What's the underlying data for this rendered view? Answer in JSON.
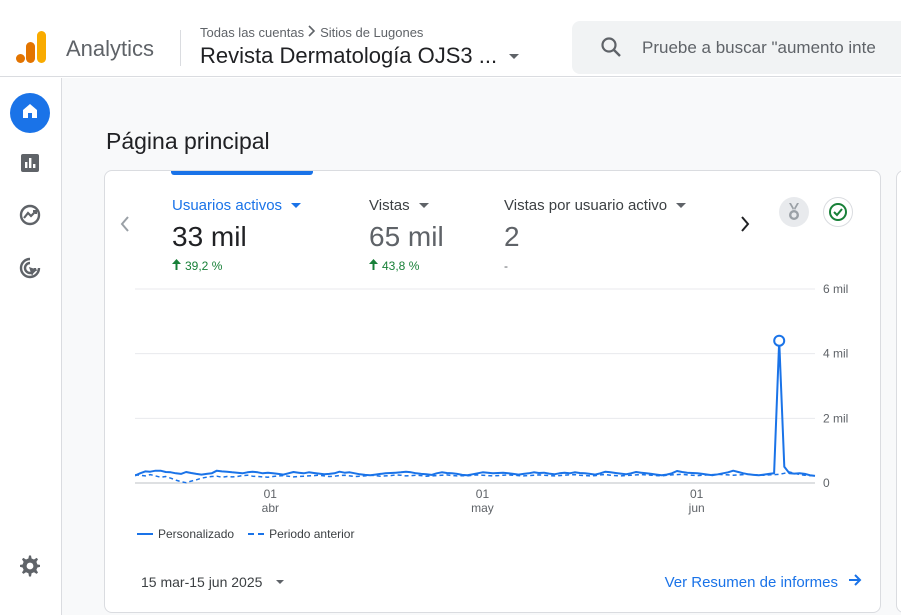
{
  "app": {
    "name": "Analytics"
  },
  "breadcrumb": {
    "account": "Todas las cuentas",
    "property_group": "Sitios de Lugones"
  },
  "property": {
    "name": "Revista Dermatología OJS3 ..."
  },
  "search": {
    "placeholder": "Pruebe a buscar \"aumento inte"
  },
  "nav": {
    "items": [
      "home-icon",
      "reports-icon",
      "explore-icon",
      "advertising-icon"
    ],
    "settings": "gear-icon"
  },
  "page": {
    "title": "Página principal"
  },
  "metrics": [
    {
      "label": "Usuarios activos",
      "value": "33 mil",
      "change": "39,2 %"
    },
    {
      "label": "Vistas",
      "value": "65 mil",
      "change": "43,8 %"
    },
    {
      "label": "Vistas por usuario activo",
      "value": "2",
      "change": "-"
    }
  ],
  "colors": {
    "accent": "#1a73e8",
    "positive": "#188038"
  },
  "chart_data": {
    "type": "line",
    "yticks": [
      "6 mil",
      "4 mil",
      "2 mil",
      "0"
    ],
    "xticks": [
      {
        "day": "01",
        "month": "abr"
      },
      {
        "day": "01",
        "month": "may"
      },
      {
        "day": "01",
        "month": "jun"
      }
    ],
    "ylim": [
      0,
      6000
    ],
    "series": [
      {
        "name": "Personalizado",
        "style": "solid",
        "values": [
          230,
          300,
          360,
          350,
          380,
          380,
          340,
          330,
          300,
          280,
          340,
          310,
          280,
          260,
          280,
          300,
          380,
          360,
          350,
          330,
          320,
          300,
          330,
          350,
          330,
          300,
          320,
          300,
          280,
          260,
          300,
          340,
          320,
          300,
          330,
          310,
          290,
          270,
          280,
          300,
          350,
          320,
          330,
          300,
          270,
          250,
          240,
          260,
          280,
          300,
          310,
          320,
          330,
          350,
          330,
          300,
          280,
          270,
          250,
          300,
          330,
          310,
          300,
          280,
          250,
          240,
          270,
          300,
          330,
          320,
          300,
          310,
          320,
          300,
          280,
          260,
          280,
          300,
          330,
          310,
          320,
          290,
          270,
          300,
          320,
          300,
          330,
          310,
          300,
          280,
          260,
          300,
          350,
          330,
          310,
          290,
          270,
          300,
          340,
          320,
          300,
          280,
          260,
          240,
          260,
          300,
          370,
          340,
          320,
          310,
          300,
          280,
          260,
          240,
          270,
          300,
          330,
          380,
          340,
          300,
          270,
          250,
          240,
          260,
          280,
          300,
          4400,
          500,
          300,
          290,
          300,
          280,
          240,
          220
        ]
      },
      {
        "name": "Periodo anterior",
        "style": "dashed",
        "values": [
          250,
          240,
          220,
          260,
          220,
          180,
          200,
          150,
          90,
          40,
          10,
          60,
          100,
          150,
          180,
          200,
          210,
          180,
          200,
          190,
          200,
          230,
          240,
          210,
          200,
          190,
          180,
          200,
          220,
          230,
          210,
          190,
          200,
          210,
          220,
          230,
          240,
          220,
          200,
          210,
          230,
          240,
          220,
          200,
          210,
          220,
          240,
          230,
          210,
          220,
          230,
          250,
          240,
          220,
          230,
          240,
          230,
          210,
          220,
          230,
          240,
          250,
          230,
          220,
          230,
          220,
          240,
          250,
          240,
          230,
          220,
          230,
          240,
          250,
          240,
          230,
          220,
          230,
          240,
          250,
          240,
          230,
          220,
          230,
          240,
          250,
          260,
          240,
          230,
          220,
          230,
          250,
          260,
          240,
          230,
          220,
          230,
          240,
          250,
          260,
          250,
          240,
          230,
          220,
          240,
          250,
          260,
          270,
          250,
          240,
          230,
          240,
          250,
          260,
          270,
          260,
          250,
          240,
          250,
          260,
          270,
          260,
          250,
          240,
          250,
          260,
          270,
          300,
          340,
          300,
          260,
          240,
          230,
          220
        ]
      }
    ]
  },
  "footer": {
    "date_range": "15 mar-15 jun 2025",
    "link": "Ver Resumen de informes"
  }
}
